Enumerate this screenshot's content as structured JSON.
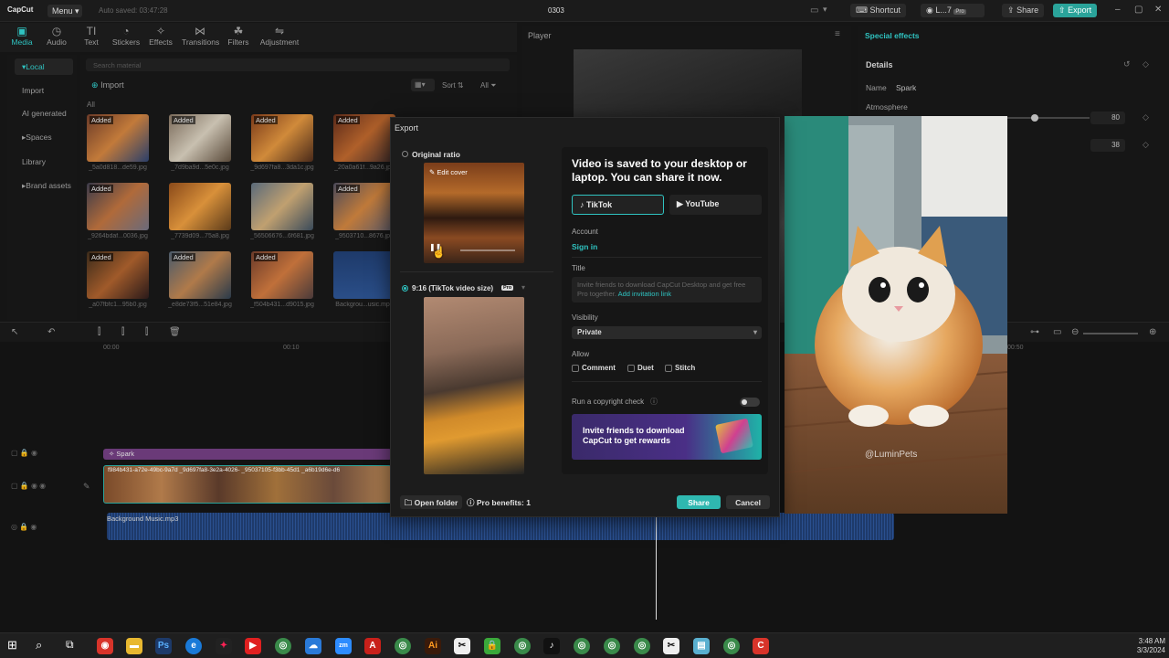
{
  "titlebar": {
    "app_name": "CapCut",
    "menu": "Menu",
    "autosave": "Auto saved: 03:47:28",
    "project": "0303",
    "shortcut": "Shortcut",
    "account": "L...7",
    "pro": "Pro",
    "share": "Share",
    "export": "Export"
  },
  "toolbar": {
    "items": [
      "Media",
      "Audio",
      "Text",
      "Stickers",
      "Effects",
      "Transitions",
      "Filters",
      "Adjustment"
    ]
  },
  "leftnav": {
    "items": [
      "Local",
      "Import",
      "AI generated",
      "Spaces",
      "Library",
      "Brand assets"
    ]
  },
  "media": {
    "search_placeholder": "Search material",
    "import": "Import",
    "sort": "Sort",
    "all_filter": "All",
    "all_label": "All",
    "added": "Added",
    "files": [
      "_5a0d818...de59.jpg",
      "_7d9ba9d...5e0c.jpg",
      "_9d697fa8...3da1c.jpg",
      "_20a0a61f...9a26.jpg",
      "_9264bdaf...0036.jpg",
      "_7739d09...75a8.jpg",
      "_56506676...6f681.jpg",
      "_9503710...8676.jpg",
      "_a07fbfc1...95b0.jpg",
      "_e8de73f5...51e84.jpg",
      "_f504b431...d9015.jpg",
      "Backgrou...usic.mp3"
    ]
  },
  "player": {
    "label": "Player"
  },
  "rightpanel": {
    "tab": "Special effects",
    "details": "Details",
    "name_label": "Name",
    "name_value": "Spark",
    "atmosphere": "Atmosphere",
    "value1": "80",
    "value2": "38"
  },
  "timeline": {
    "ruler": [
      "00:00",
      "00:10"
    ],
    "ruler_right": "00:50",
    "effect_clip": "Spark",
    "video_clips": "f984b431-a72e-49bc-9a7d   _9d697fa8-3e2a-4026-   _95037105-f3bb-45d1   _a6b19d6e-d6",
    "audio_clip": "Background Music.mp3"
  },
  "dialog": {
    "title": "Export",
    "original_ratio": "Original ratio",
    "edit_cover": "Edit cover",
    "tiktok_size": "9:16 (TikTok video size)",
    "pro_badge": "Pro",
    "headline": "Video is saved to your desktop or laptop. You can share it now.",
    "platform_tiktok": "TikTok",
    "platform_youtube": "YouTube",
    "account_label": "Account",
    "sign_in": "Sign in",
    "title_label": "Title",
    "title_placeholder": "Invite friends to download CapCut Desktop and get free Pro together.",
    "invite_link": "Add invitation link",
    "visibility_label": "Visibility",
    "visibility_value": "Private",
    "allow_label": "Allow",
    "allow_comment": "Comment",
    "allow_duet": "Duet",
    "allow_stitch": "Stitch",
    "copyright": "Run a copyright check",
    "banner_text": "Invite friends to download CapCut to get rewards",
    "open_folder": "Open folder",
    "pro_benefits": "Pro benefits: 1",
    "share": "Share",
    "cancel": "Cancel"
  },
  "catimage": {
    "watermark": "@LuminPets"
  },
  "taskbar": {
    "time": "3:48 AM",
    "date": "3/3/2024"
  },
  "colors": {
    "accent": "#2fc3c1",
    "export_btn": "#2aa39a",
    "background": "#151515"
  }
}
